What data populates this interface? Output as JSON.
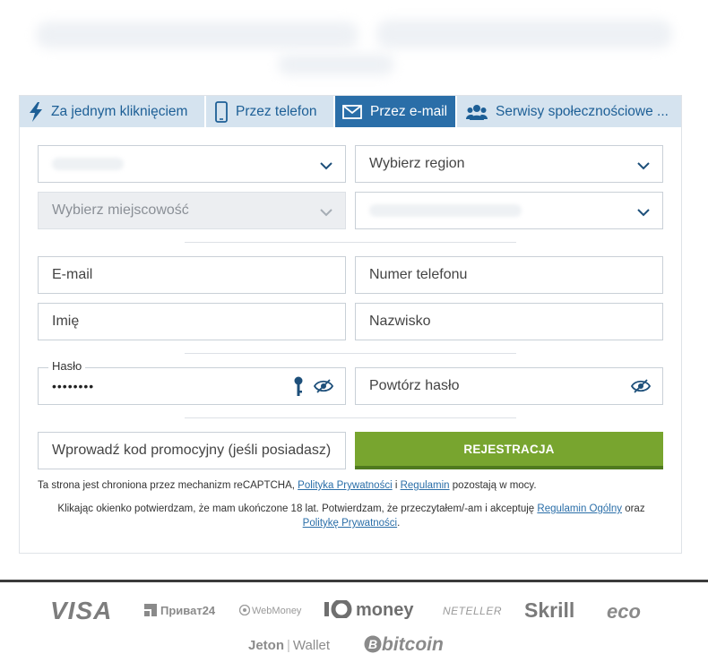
{
  "tabs": [
    {
      "label": "Za jednym kliknięciem",
      "icon": "lightning-icon"
    },
    {
      "label": "Przez telefon",
      "icon": "phone-icon"
    },
    {
      "label": "Przez e-mail",
      "icon": "envelope-icon",
      "active": true
    },
    {
      "label": "Serwisy społecznościowe ...",
      "icon": "users-icon"
    }
  ],
  "selects": {
    "region_placeholder": "Wybierz region",
    "city_placeholder": "Wybierz miejscowość"
  },
  "fields": {
    "email_placeholder": "E-mail",
    "phone_placeholder": "Numer telefonu",
    "first_name_placeholder": "Imię",
    "last_name_placeholder": "Nazwisko",
    "password_label": "Hasło",
    "password_value": "••••••••",
    "repeat_password_placeholder": "Powtórz hasło",
    "promo_placeholder": "Wprowadź kod promocyjny (jeśli posiadasz)"
  },
  "register_button": "REJESTRACJA",
  "recaptcha_note": {
    "prefix": "Ta strona jest chroniona przez mechanizm reCAPTCHA, ",
    "link1": "Polityka Prywatności",
    "mid": " i ",
    "link2": "Regulamin",
    "suffix": " pozostają w mocy."
  },
  "age_note": {
    "prefix": "Klikając okienko potwierdzam, że mam ukończone 18 lat. Potwierdzam, że przeczytałem/-am i akceptuję ",
    "link1": "Regulamin Ogólny",
    "mid": " oraz",
    "link2": "Politykę Prywatności",
    "suffix": "."
  },
  "payment_logos": {
    "visa": "VISA",
    "privat24": "Приват24",
    "webmoney": "WebMoney",
    "money": "money",
    "neteller": "NETELLER",
    "skrill": "Skrill",
    "eco": "eco",
    "jeton": "Jeton",
    "wallet": "Wallet",
    "bitcoin": "bitcoin"
  },
  "colors": {
    "tab_bg": "#d5e3ef",
    "tab_active": "#2a6ea8",
    "button_green": "#78a52f",
    "link_blue": "#2a6ea8"
  }
}
